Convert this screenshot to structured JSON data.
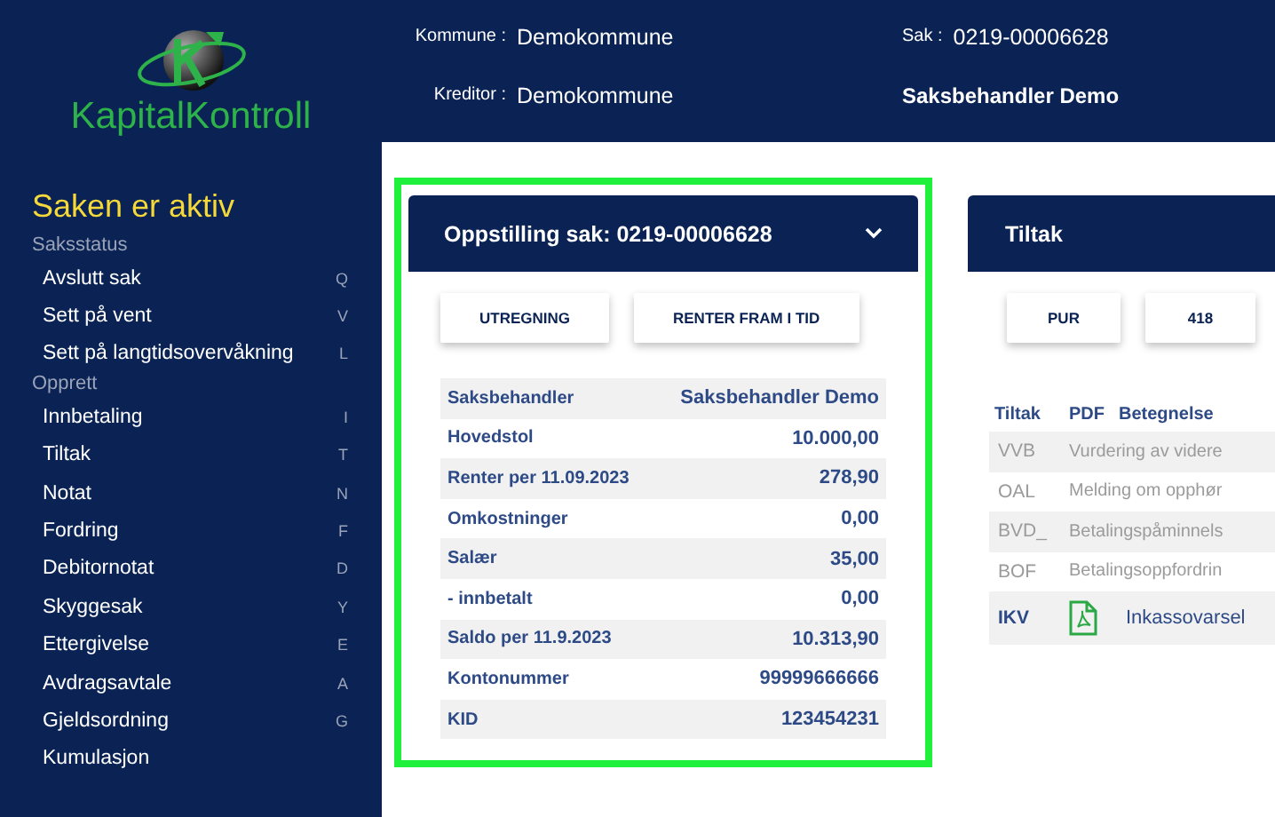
{
  "logo": {
    "text": "KapitalKontroll"
  },
  "header": {
    "fields": [
      {
        "label": "Kommune :",
        "value": "Demokommune"
      },
      {
        "label": "Kreditor :",
        "value": "Demokommune"
      }
    ],
    "case": {
      "label": "Sak :",
      "value": "0219-00006628"
    },
    "handler": "Saksbehandler Demo"
  },
  "sidebar": {
    "status_title": "Saken er aktiv",
    "sections": [
      {
        "title": "Saksstatus",
        "items": [
          {
            "label": "Avslutt sak",
            "key": "Q"
          },
          {
            "label": "Sett på vent",
            "key": "V"
          },
          {
            "label": "Sett på langtidsovervåkning",
            "key": "L"
          }
        ]
      },
      {
        "title": "Opprett",
        "items": [
          {
            "label": "Innbetaling",
            "key": "I"
          },
          {
            "label": "Tiltak",
            "key": "T"
          },
          {
            "label": "Notat",
            "key": "N"
          },
          {
            "label": "Fordring",
            "key": "F"
          },
          {
            "label": "Debitornotat",
            "key": "D"
          },
          {
            "label": "Skyggesak",
            "key": "Y"
          },
          {
            "label": "Ettergivelse",
            "key": "E"
          },
          {
            "label": "Avdragsavtale",
            "key": "A"
          },
          {
            "label": "Gjeldsordning",
            "key": "G"
          },
          {
            "label": "Kumulasjon"
          }
        ]
      }
    ]
  },
  "summary_panel": {
    "title": "Oppstilling sak: 0219-00006628",
    "highlighted": true,
    "expanded": false,
    "buttons": [
      "UTREGNING",
      "RENTER FRAM I TID"
    ],
    "rows": [
      {
        "label": "Saksbehandler",
        "value": "Saksbehandler Demo"
      },
      {
        "label": "Hovedstol",
        "value": "10.000,00"
      },
      {
        "label": "Renter per 11.09.2023",
        "value": "278,90"
      },
      {
        "label": "Omkostninger",
        "value": "0,00"
      },
      {
        "label": "Salær",
        "value": "35,00"
      },
      {
        "label": "- innbetalt",
        "value": "0,00"
      },
      {
        "label": "Saldo per 11.9.2023",
        "value": "10.313,90"
      },
      {
        "label": "Kontonummer",
        "value": "99999666666"
      },
      {
        "label": "KID",
        "value": "123454231"
      }
    ]
  },
  "measures_panel": {
    "title": "Tiltak",
    "buttons": [
      "PUR",
      "418"
    ],
    "columns": [
      "Tiltak",
      "PDF",
      "Betegnelse"
    ],
    "rows": [
      {
        "code": "VVB",
        "description": "Vurdering av videre",
        "active": false,
        "has_pdf": false
      },
      {
        "code": "OAL",
        "description": "Melding om opphør",
        "active": false,
        "has_pdf": false
      },
      {
        "code": "BVD_",
        "description": "Betalingspåminnels",
        "active": false,
        "has_pdf": false
      },
      {
        "code": "BOF",
        "description": "Betalingsoppfordrin",
        "active": false,
        "has_pdf": false
      },
      {
        "code": "IKV",
        "description": "Inkassovarsel",
        "active": true,
        "has_pdf": true
      }
    ]
  }
}
